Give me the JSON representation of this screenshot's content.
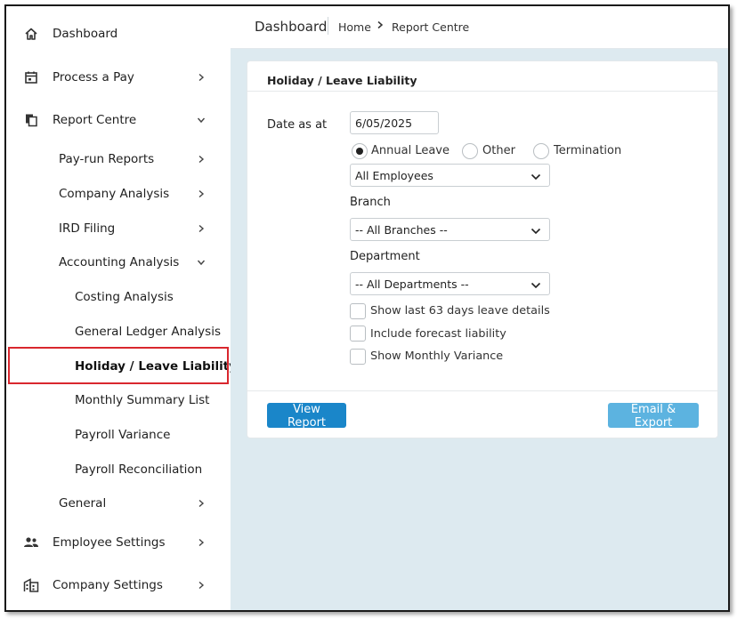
{
  "sidebar": {
    "items": [
      {
        "label": "Dashboard",
        "icon": "home-icon"
      },
      {
        "label": "Process a Pay",
        "icon": "calendar-icon"
      },
      {
        "label": "Report Centre",
        "icon": "documents-icon"
      },
      {
        "label": "Pay-run Reports"
      },
      {
        "label": "Company Analysis"
      },
      {
        "label": "IRD Filing"
      },
      {
        "label": "Accounting Analysis"
      },
      {
        "label": "Costing Analysis"
      },
      {
        "label": "General Ledger Analysis"
      },
      {
        "label": "Holiday / Leave Liability"
      },
      {
        "label": "Monthly Summary List"
      },
      {
        "label": "Payroll Variance"
      },
      {
        "label": "Payroll Reconciliation"
      },
      {
        "label": "General"
      },
      {
        "label": "Employee Settings",
        "icon": "people-icon"
      },
      {
        "label": "Company Settings",
        "icon": "building-icon"
      }
    ]
  },
  "header": {
    "title": "Dashboard",
    "breadcrumb": [
      "Home",
      "Report Centre"
    ]
  },
  "report": {
    "title": "Holiday / Leave Liability",
    "date_label": "Date as at",
    "date_value": "6/05/2025",
    "radio_options": [
      "Annual Leave",
      "Other",
      "Termination"
    ],
    "selected_option": "Annual Leave",
    "employees_select": "All Employees",
    "branch_label": "Branch",
    "branch_select": "-- All Branches --",
    "department_label": "Department",
    "department_select": "-- All Departments --",
    "checkboxes": [
      "Show last 63 days leave details",
      "Include forecast liability",
      "Show Monthly Variance"
    ],
    "view_button": "View Report",
    "export_button": "Email & Export"
  },
  "colors": {
    "accent": "#1a86c9",
    "secondary_button": "#5cb3e0",
    "main_bg": "#ddeaf0",
    "highlight": "#d9272e"
  }
}
